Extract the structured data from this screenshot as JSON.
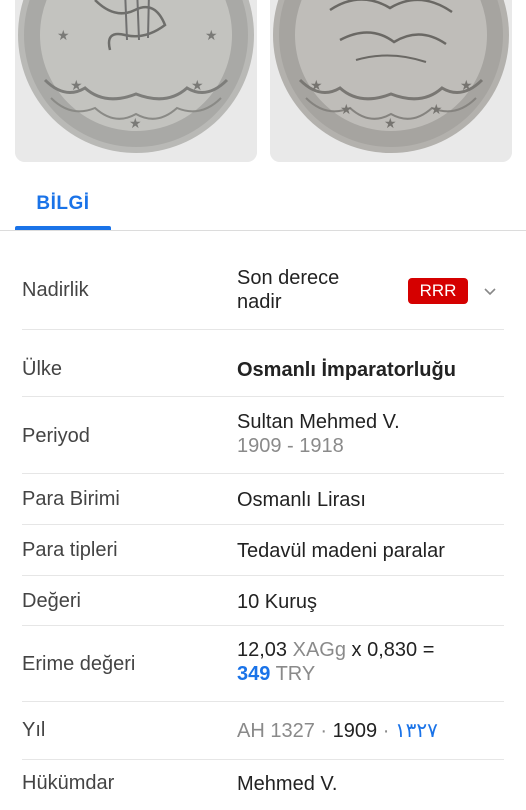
{
  "tabs": {
    "active": "BİLGİ"
  },
  "rows": {
    "rarity": {
      "label": "Nadirlik",
      "value_line1": "Son derece",
      "value_line2": "nadir",
      "badge": "RRR"
    },
    "country": {
      "label": "Ülke",
      "value": "Osmanlı İmparatorluğu"
    },
    "period": {
      "label": "Periyod",
      "value": "Sultan Mehmed V.",
      "years": "1909 - 1918"
    },
    "currency": {
      "label": "Para Birimi",
      "value": "Osmanlı Lirası"
    },
    "types": {
      "label": "Para tipleri",
      "value": "Tedavül madeni paralar"
    },
    "denomination": {
      "label": "Değeri",
      "value": "10 Kuruş"
    },
    "melt": {
      "label": "Erime değeri",
      "weight": "12,03",
      "unit": "XAGg",
      "factor": "x 0,830 =",
      "amount": "349",
      "currency": "TRY"
    },
    "year": {
      "label": "Yıl",
      "ah": "AH 1327",
      "sep1": "·",
      "greg": "1909",
      "sep2": "·",
      "arabic": "١٣٢٧"
    },
    "ruler": {
      "label": "Hükümdar",
      "value": "Mehmed V."
    }
  },
  "colors": {
    "accent": "#1a73e8",
    "badge": "#d50000"
  },
  "icons": {
    "chevron": "chevron-down-icon"
  }
}
